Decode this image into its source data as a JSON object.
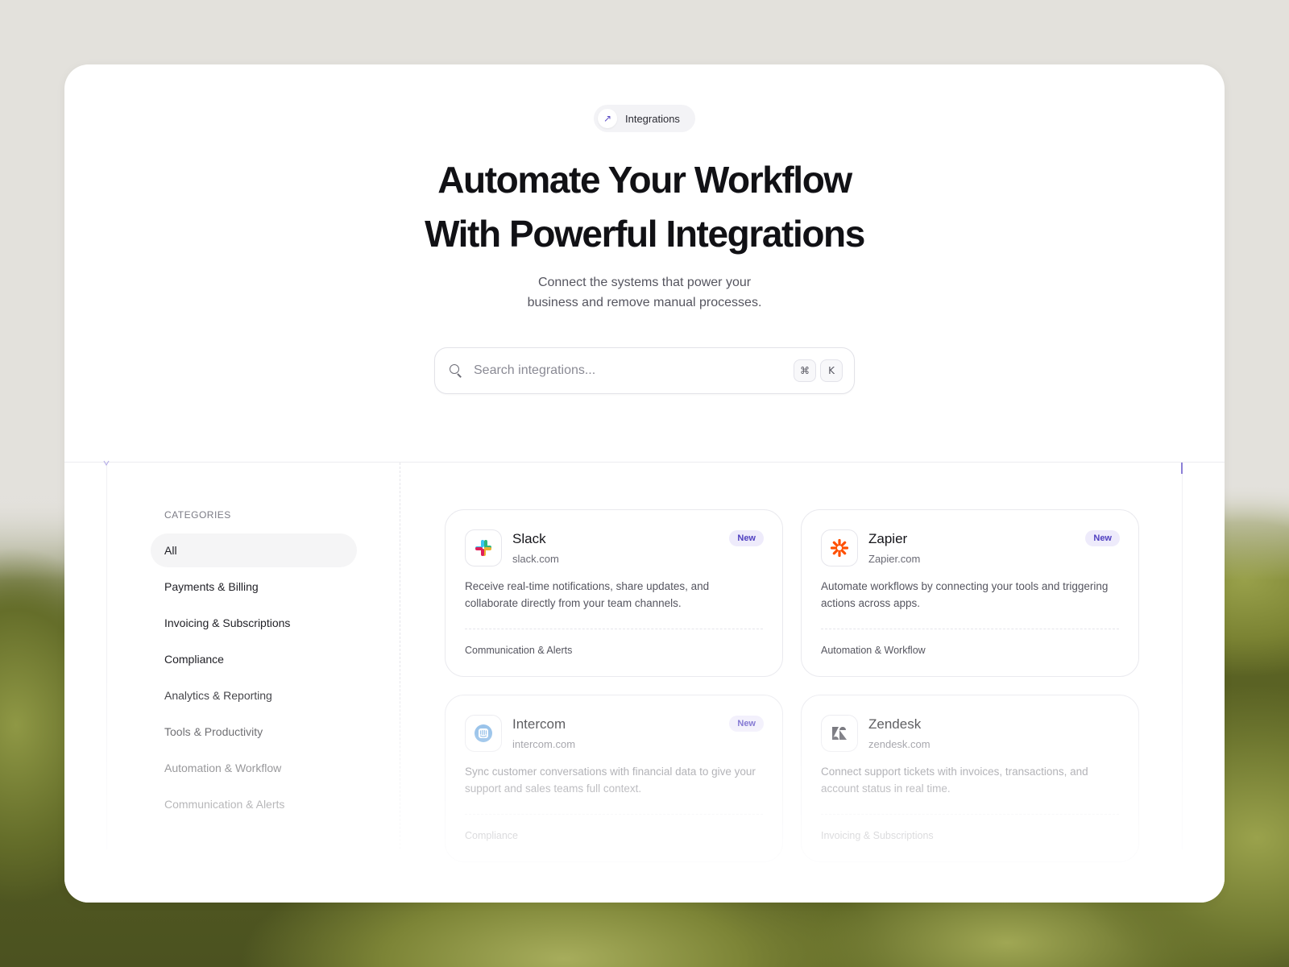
{
  "hero": {
    "pill_label": "Integrations",
    "pill_icon": "arrow-up-right-icon",
    "title_line1": "Automate Your Workflow",
    "title_line2": "With Powerful Integrations",
    "subtitle_line1": "Connect the systems that power your",
    "subtitle_line2": "business and remove manual processes."
  },
  "search": {
    "placeholder": "Search integrations...",
    "shortcut_mod": "⌘",
    "shortcut_key": "K"
  },
  "categories": {
    "heading": "CATEGORIES",
    "items": [
      {
        "label": "All",
        "active": true
      },
      {
        "label": "Payments & Billing"
      },
      {
        "label": "Invoicing & Subscriptions"
      },
      {
        "label": "Compliance"
      },
      {
        "label": "Analytics & Reporting"
      },
      {
        "label": "Tools & Productivity"
      },
      {
        "label": "Automation & Workflow"
      },
      {
        "label": "Communication & Alerts"
      }
    ]
  },
  "integrations": [
    {
      "name": "Slack",
      "domain": "slack.com",
      "badge": "New",
      "description": "Receive real-time notifications, share updates, and collaborate directly from your team channels.",
      "category": "Communication & Alerts",
      "icon": "slack-logo-icon"
    },
    {
      "name": "Zapier",
      "domain": "Zapier.com",
      "badge": "New",
      "description": "Automate workflows by connecting your tools and triggering actions across apps.",
      "category": "Automation & Workflow",
      "icon": "zapier-logo-icon"
    },
    {
      "name": "Intercom",
      "domain": "intercom.com",
      "badge": "New",
      "description": "Sync customer conversations with financial data to give your support and sales teams full context.",
      "category": "Compliance",
      "icon": "intercom-logo-icon"
    },
    {
      "name": "Zendesk",
      "domain": "zendesk.com",
      "badge": "",
      "description": "Connect support tickets with invoices, transactions, and account status in real time.",
      "category": "Invoicing & Subscriptions",
      "icon": "zendesk-logo-icon"
    }
  ],
  "colors": {
    "accent": "#4f3fc0",
    "badge_bg": "#eeebfb",
    "zapier_orange": "#ff4f00",
    "intercom_blue": "#6aa7e0"
  }
}
